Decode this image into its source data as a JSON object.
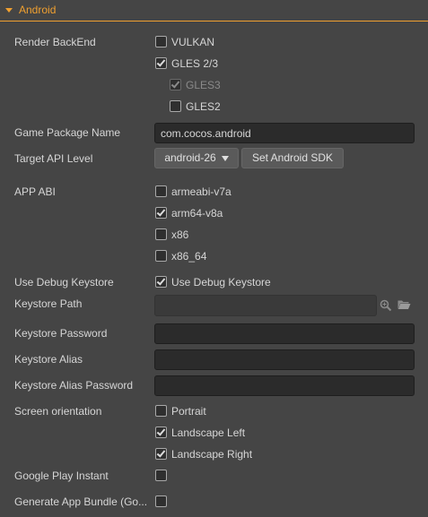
{
  "section": {
    "title": "Android"
  },
  "render_backend": {
    "label": "Render BackEnd",
    "options": [
      {
        "label": "VULKAN",
        "checked": false
      },
      {
        "label": "GLES 2/3",
        "checked": true
      },
      {
        "label": "GLES3",
        "checked": true,
        "disabled": true
      },
      {
        "label": "GLES2",
        "checked": false
      }
    ]
  },
  "game_package_name": {
    "label": "Game Package Name",
    "value": "com.cocos.android"
  },
  "target_api_level": {
    "label": "Target API Level",
    "value": "android-26",
    "set_sdk_button": "Set Android SDK"
  },
  "app_abi": {
    "label": "APP ABI",
    "options": [
      {
        "label": "armeabi-v7a",
        "checked": false
      },
      {
        "label": "arm64-v8a",
        "checked": true
      },
      {
        "label": "x86",
        "checked": false
      },
      {
        "label": "x86_64",
        "checked": false
      }
    ]
  },
  "use_debug_keystore": {
    "label": "Use Debug Keystore",
    "checkbox_label": "Use Debug Keystore",
    "checked": true
  },
  "keystore_path": {
    "label": "Keystore Path",
    "value": ""
  },
  "keystore_password": {
    "label": "Keystore Password",
    "value": ""
  },
  "keystore_alias": {
    "label": "Keystore Alias",
    "value": ""
  },
  "keystore_alias_password": {
    "label": "Keystore Alias Password",
    "value": ""
  },
  "screen_orientation": {
    "label": "Screen orientation",
    "options": [
      {
        "label": "Portrait",
        "checked": false
      },
      {
        "label": "Landscape Left",
        "checked": true
      },
      {
        "label": "Landscape Right",
        "checked": true
      }
    ]
  },
  "google_play_instant": {
    "label": "Google Play Instant",
    "checked": false
  },
  "generate_app_bundle": {
    "label": "Generate App Bundle (Go...",
    "checked": false
  },
  "icons": {
    "search": "magnifier-icon",
    "folder": "folder-icon"
  },
  "colors": {
    "accent": "#f0a030",
    "background": "#454545",
    "input_bg": "#2b2b2b"
  }
}
